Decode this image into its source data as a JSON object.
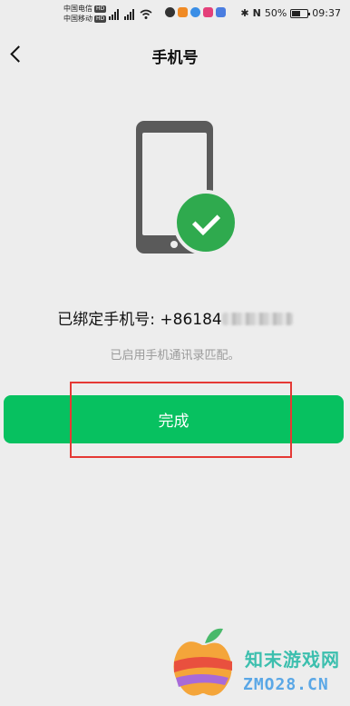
{
  "status_bar": {
    "carrier_1": "中国电信",
    "carrier_2": "中国移动",
    "hd_badge": "HD",
    "battery_percent": "50%",
    "time": "09:37"
  },
  "nav": {
    "title": "手机号"
  },
  "content": {
    "bound_label": "已绑定手机号: +86184",
    "sub_text": "已启用手机通讯录匹配。",
    "done_button": "完成"
  },
  "watermark": {
    "line1": "知末游戏网",
    "line2": "ZMO28.CN"
  },
  "colors": {
    "primary_green": "#07c160",
    "check_green": "#2faa4e",
    "highlight_red": "#e53935"
  }
}
